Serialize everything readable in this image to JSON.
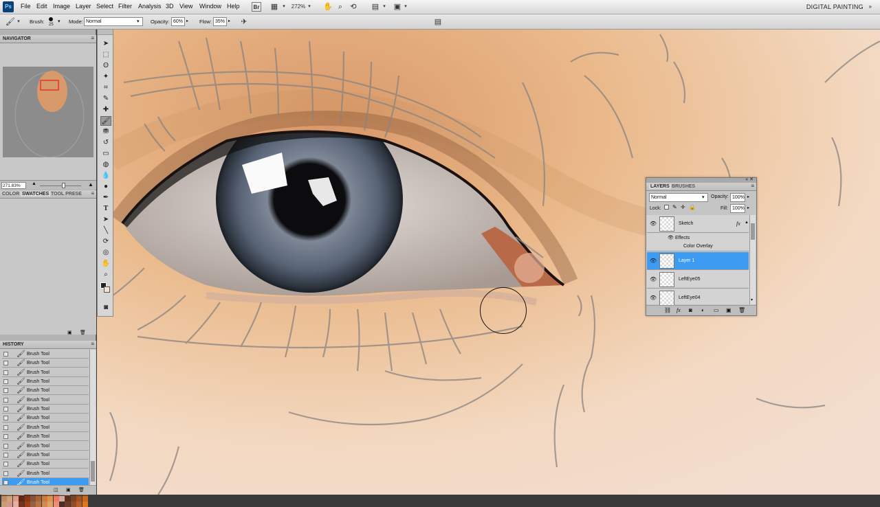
{
  "app": {
    "logo": "Ps",
    "workspace": "DIGITAL PAINTING"
  },
  "menus": [
    "File",
    "Edit",
    "Image",
    "Layer",
    "Select",
    "Filter",
    "Analysis",
    "3D",
    "View",
    "Window",
    "Help"
  ],
  "appbar": {
    "zoom": "272%"
  },
  "options": {
    "brush_label": "Brush:",
    "brush_size": "25",
    "mode_label": "Mode:",
    "mode_value": "Normal",
    "opacity_label": "Opacity:",
    "opacity_value": "60%",
    "flow_label": "Flow:",
    "flow_value": "35%"
  },
  "navigator": {
    "title": "NAVIGATOR",
    "zoom": "271.83%"
  },
  "color_panel": {
    "tabs": [
      "COLOR",
      "SWATCHES",
      "TOOL PRESE"
    ]
  },
  "history": {
    "title": "HISTORY",
    "items": [
      "Brush Tool",
      "Brush Tool",
      "Brush Tool",
      "Brush Tool",
      "Brush Tool",
      "Brush Tool",
      "Brush Tool",
      "Brush Tool",
      "Brush Tool",
      "Brush Tool",
      "Brush Tool",
      "Brush Tool",
      "Brush Tool",
      "Brush Tool",
      "Brush Tool"
    ]
  },
  "layers": {
    "tabs": [
      "LAYERS",
      "BRUSHES"
    ],
    "blend_mode": "Normal",
    "opacity_label": "Opacity:",
    "opacity_value": "100%",
    "lock_label": "Lock:",
    "fill_label": "Fill:",
    "fill_value": "100%",
    "items": [
      {
        "name": "Sketch",
        "fx": "fx"
      },
      {
        "name": "Effects"
      },
      {
        "name": "Color Overlay"
      },
      {
        "name": "Layer 1"
      },
      {
        "name": "LeftEye05"
      },
      {
        "name": "LeftEye04"
      }
    ]
  },
  "colors": {
    "accent": "#3d9cf2",
    "skin": "#eab98a",
    "iris": "#5b6a7c"
  },
  "icons": [
    "ps-logo",
    "bridge-icon",
    "hand-icon",
    "zoom-icon",
    "rotate-icon",
    "arrange-icon",
    "screen-mode-icon",
    "brush-icon",
    "airbrush-icon",
    "eye-icon",
    "fx-icon",
    "trash-icon",
    "new-layer-icon",
    "folder-icon",
    "link-icon",
    "mask-icon",
    "adjustment-icon",
    "lock-icon"
  ]
}
